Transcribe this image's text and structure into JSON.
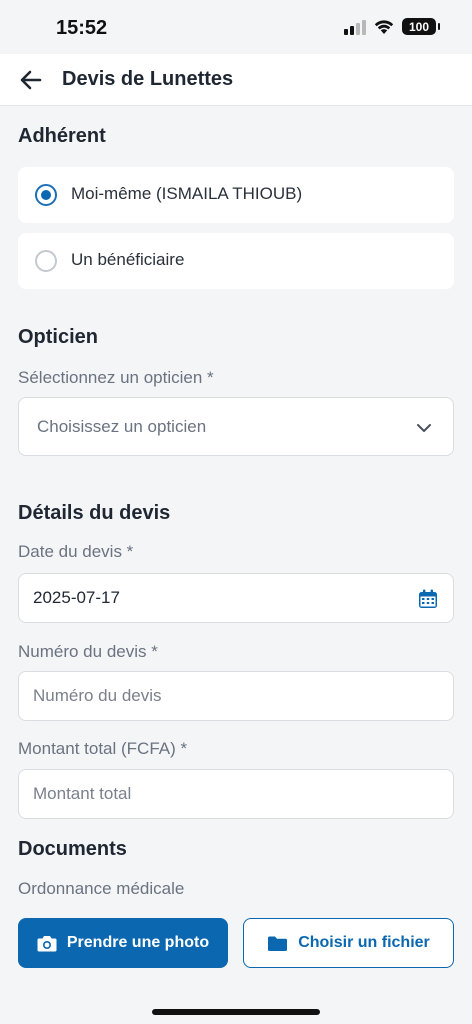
{
  "status_bar": {
    "time": "15:52",
    "battery": "100"
  },
  "header": {
    "title": "Devis de Lunettes"
  },
  "adherent": {
    "title": "Adhérent",
    "options": [
      {
        "label": "Moi-même (ISMAILA  THIOUB)",
        "selected": true
      },
      {
        "label": "Un bénéficiaire",
        "selected": false
      }
    ]
  },
  "opticien": {
    "title": "Opticien",
    "label": "Sélectionnez un opticien *",
    "select_placeholder": "Choisissez un opticien"
  },
  "details": {
    "title": "Détails du devis",
    "date_label": "Date du devis *",
    "date_value": "2025-07-17",
    "numero_label": "Numéro du devis *",
    "numero_placeholder": "Numéro du devis",
    "montant_label": "Montant total (FCFA) *",
    "montant_placeholder": "Montant total"
  },
  "documents": {
    "title": "Documents",
    "ordonnance_label": "Ordonnance médicale",
    "photo_button": "Prendre une photo",
    "file_button": "Choisir un fichier"
  },
  "colors": {
    "primary": "#0b68b0",
    "background": "#f4f5f7"
  }
}
